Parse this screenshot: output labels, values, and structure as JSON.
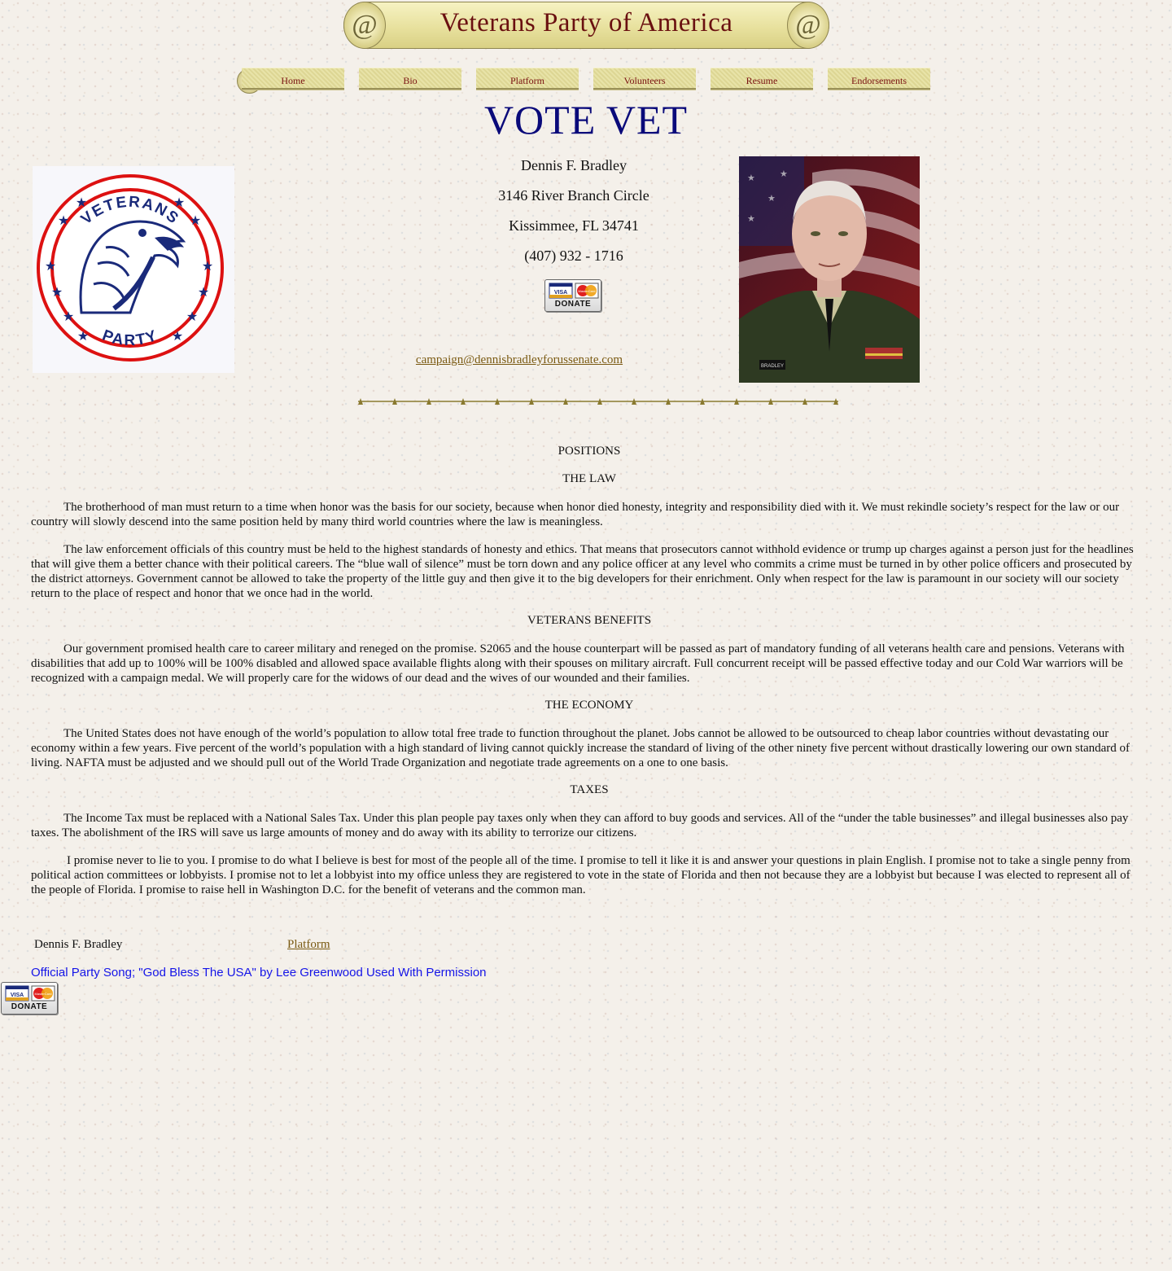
{
  "banner": {
    "title": "Veterans Party of America"
  },
  "nav": {
    "items": [
      {
        "label": "Home"
      },
      {
        "label": "Bio"
      },
      {
        "label": "Platform"
      },
      {
        "label": "Volunteers"
      },
      {
        "label": "Resume"
      },
      {
        "label": "Endorsements"
      }
    ]
  },
  "headline": "VOTE VET",
  "logo": {
    "top_text": "VETERANS",
    "bottom_text": "PARTY"
  },
  "contact": {
    "name": "Dennis F. Bradley",
    "street": "3146 River Branch Circle",
    "city": "Kissimmee, FL 34741",
    "phone": "(407) 932 - 1716",
    "email": "campaign@dennisbradleyforussenate.com"
  },
  "donate": {
    "label": "DONATE",
    "card1": "VISA",
    "card2": "MasterCard"
  },
  "photo": {
    "name_tag": "BRADLEY"
  },
  "positions": {
    "title": "POSITIONS",
    "law": {
      "heading": "THE LAW",
      "p1": "The brotherhood of man must return to a time when honor was the basis for our society, because when honor died honesty, integrity and responsibility died with it.  We must rekindle society’s respect for the law or our country will slowly descend into the same position held by many third world countries where the law is meaningless.",
      "p2": "The law enforcement officials of this country must be held to the highest standards of honesty and ethics.  That means that prosecutors cannot withhold evidence or trump up charges against a person just for the headlines that will give them a better chance with their political careers.  The “blue wall of silence” must be torn down and any police officer at any level who commits a crime must be turned in by other police officers and prosecuted by the district attorneys.  Government cannot be allowed to take the property of the little guy and then give it to the big developers for their enrichment.  Only when respect for the law is paramount in our society will our society return to the place of respect and honor that we once had in the world."
    },
    "veterans": {
      "heading": "VETERANS BENEFITS",
      "p1": "Our government promised health care to career military and reneged on the promise.  S2065 and the house counterpart will be passed as part of mandatory funding of all veterans health care and pensions.  Veterans with disabilities that add up to 100% will be 100% disabled and allowed space available flights along with their spouses on military aircraft.  Full concurrent receipt will be passed effective today and our Cold War warriors will be recognized with a campaign medal.  We will properly care for the widows of our dead and the wives of our wounded and their families."
    },
    "economy": {
      "heading": "THE ECONOMY",
      "p1": "The United States does not have enough of the world’s population to allow total free trade to function throughout the planet.  Jobs cannot be allowed to be outsourced to cheap labor countries without devastating our economy within a few years.  Five percent of the world’s population with a high standard of living cannot quickly increase the standard of living of the other ninety five percent without drastically lowering our own standard of living.  NAFTA must be adjusted and we should pull out of the World Trade Organization and negotiate trade agreements on a one to one basis."
    },
    "taxes": {
      "heading": "TAXES",
      "p1": "The Income Tax must be replaced with a National Sales Tax.  Under this plan people pay taxes only when they can afford to buy goods and services.  All of the “under the table businesses” and illegal businesses also pay taxes.  The abolishment of the IRS will save us large amounts of money and do away with its ability to terrorize our citizens."
    },
    "promise": "I promise never to lie to you. I promise to do what I believe is best for most of the people all of the time. I promise to tell it like it is and answer your questions in plain English. I promise not to take a single penny from political action committees or lobbyists. I promise not to let a lobbyist into my office unless they are registered to vote in the state of Florida and then not because they are a lobbyist but because I was elected to represent all of the people of Florida. I promise to raise hell in Washington D.C. for the benefit of veterans and the common man."
  },
  "footer": {
    "name": "Dennis F. Bradley",
    "platform_link": "Platform",
    "song": "Official Party Song; \"God Bless The USA\" by Lee Greenwood  Used With Permission"
  },
  "colors": {
    "headline": "#0a0a7a",
    "banner_text": "#6a1010",
    "link": "#7a5a12",
    "song_link": "#1515e8"
  }
}
